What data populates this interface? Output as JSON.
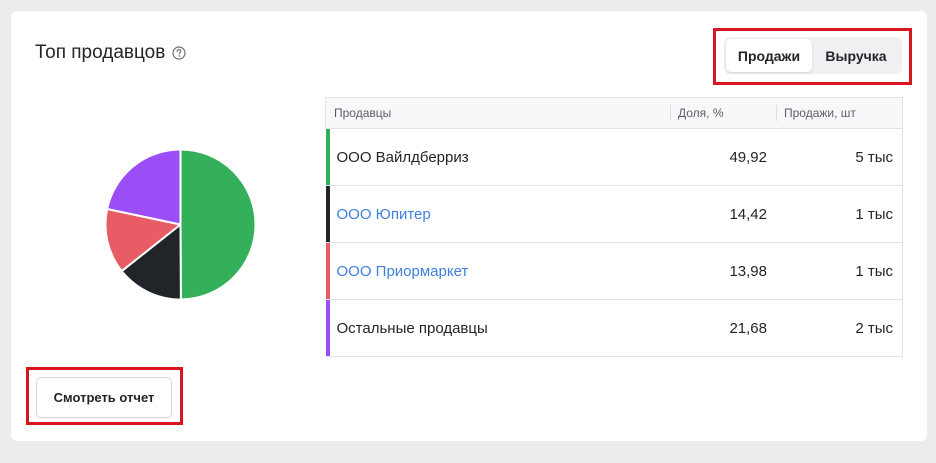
{
  "widget": {
    "title": "Топ продавцов"
  },
  "toggle": {
    "sales_label": "Продажи",
    "revenue_label": "Выручка",
    "active": "sales"
  },
  "table": {
    "headers": {
      "sellers": "Продавцы",
      "share": "Доля, %",
      "sales": "Продажи, шт"
    },
    "rows": [
      {
        "name": "ООО Вайлдберриз",
        "share": "49,92",
        "sales": "5 тыс",
        "color": "#34b05a",
        "is_link": false
      },
      {
        "name": "ООО Юпитер",
        "share": "14,42",
        "sales": "1 тыс",
        "color": "#212429",
        "is_link": true
      },
      {
        "name": "ООО Приормаркет",
        "share": "13,98",
        "sales": "1 тыс",
        "color": "#e85d65",
        "is_link": true
      },
      {
        "name": "Остальные продавцы",
        "share": "21,68",
        "sales": "2 тыс",
        "color": "#9b4ef5",
        "is_link": false
      }
    ]
  },
  "chart_data": {
    "type": "pie",
    "categories": [
      "ООО Вайлдберриз",
      "ООО Юпитер",
      "ООО Приормаркет",
      "Остальные продавцы"
    ],
    "values": [
      49.92,
      14.42,
      13.98,
      21.68
    ],
    "colors": [
      "#34b05a",
      "#212429",
      "#e85d65",
      "#9b4ef5"
    ]
  },
  "actions": {
    "report_label": "Смотреть отчет"
  },
  "colors": {
    "highlight": "#d8161d",
    "link": "#3f7fde"
  },
  "icons": {
    "help": "question-circle-icon"
  }
}
